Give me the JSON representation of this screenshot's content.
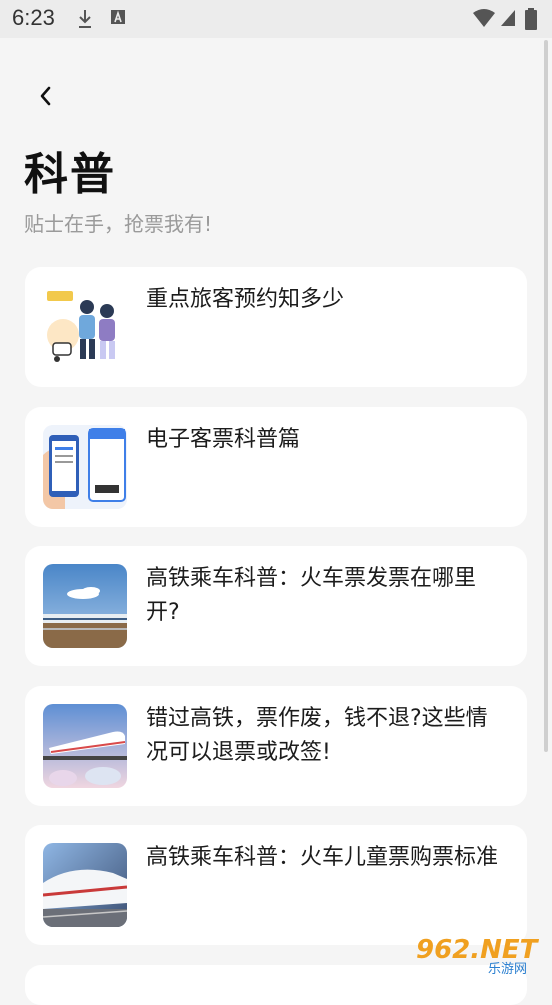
{
  "status": {
    "time": "6:23"
  },
  "header": {
    "title": "科普",
    "subtitle": "贴士在手，抢票我有!"
  },
  "articles": [
    {
      "title": "重点旅客预约知多少"
    },
    {
      "title": "电子客票科普篇"
    },
    {
      "title": "高铁乘车科普：火车票发票在哪里开?"
    },
    {
      "title": "错过高铁，票作废，钱不退?这些情况可以退票或改签!"
    },
    {
      "title": "高铁乘车科普：火车儿童票购票标准"
    }
  ],
  "watermark": {
    "text": "962.NET",
    "sub": "乐游网"
  },
  "colors": {
    "background": "#f5f5f5",
    "card": "#ffffff",
    "subtitle": "#9a9a9a"
  }
}
